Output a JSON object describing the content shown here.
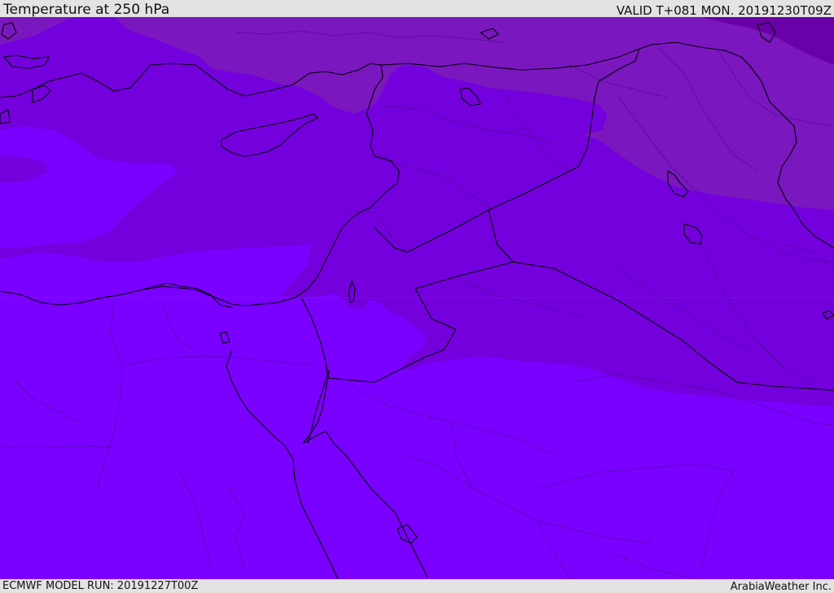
{
  "header": {
    "title": "Temperature at 250 hPa",
    "valid": "VALID T+081 MON. 20191230T09Z"
  },
  "footer": {
    "model_run": "ECMWF MODEL RUN: 20191227T00Z",
    "credit": "ArabiaWeather Inc."
  },
  "colors": {
    "warmest_band": "#7a00ff",
    "mid_band": "#7400dd",
    "cool_band": "#7a17bf",
    "coldest_band": "#6a00a8",
    "coastline": "#000000",
    "borders": "#2a0055",
    "bars": "#e3e3e3"
  }
}
